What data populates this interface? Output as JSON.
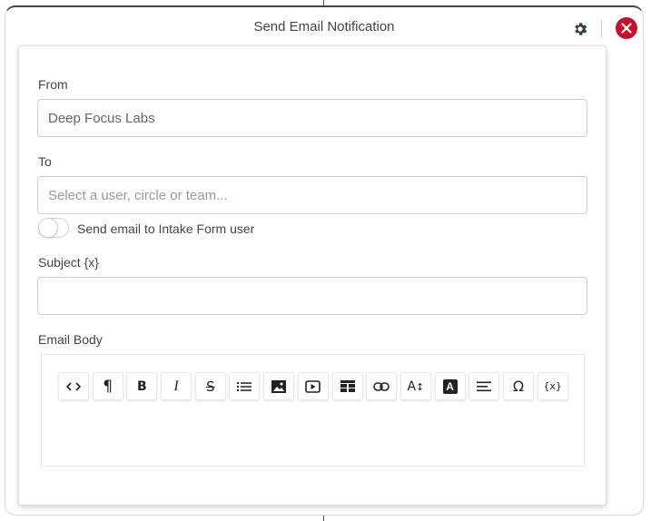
{
  "dialog": {
    "title": "Send Email Notification",
    "close_color": "#c8102e"
  },
  "form": {
    "from": {
      "label": "From",
      "value": "Deep Focus Labs"
    },
    "to": {
      "label": "To",
      "placeholder": "Select a user, circle or team..."
    },
    "intake_toggle": {
      "label": "Send email to Intake Form user",
      "checked": false
    },
    "subject": {
      "label": "Subject {x}",
      "value": ""
    },
    "body": {
      "label": "Email Body"
    }
  },
  "toolbar": {
    "buttons": [
      {
        "name": "code-view-button",
        "icon": "code-icon",
        "glyph": "<>"
      },
      {
        "name": "paragraph-format-button",
        "icon": "paragraph-icon",
        "glyph": "¶"
      },
      {
        "name": "bold-button",
        "icon": "bold-icon",
        "glyph": "B"
      },
      {
        "name": "italic-button",
        "icon": "italic-icon",
        "glyph": "I"
      },
      {
        "name": "strikethrough-button",
        "icon": "strikethrough-icon",
        "glyph": "S"
      },
      {
        "name": "bulleted-list-button",
        "icon": "list-icon",
        "glyph": ""
      },
      {
        "name": "insert-image-button",
        "icon": "image-icon",
        "glyph": ""
      },
      {
        "name": "insert-video-button",
        "icon": "video-icon",
        "glyph": ""
      },
      {
        "name": "insert-table-button",
        "icon": "table-icon",
        "glyph": ""
      },
      {
        "name": "insert-link-button",
        "icon": "link-icon",
        "glyph": ""
      },
      {
        "name": "font-size-button",
        "icon": "font-size-icon",
        "glyph": "A"
      },
      {
        "name": "text-color-button",
        "icon": "text-color-icon",
        "glyph": "A"
      },
      {
        "name": "align-button",
        "icon": "align-left-icon",
        "glyph": ""
      },
      {
        "name": "special-characters-button",
        "icon": "omega-icon",
        "glyph": "Ω"
      },
      {
        "name": "insert-variable-button",
        "icon": "variable-icon",
        "glyph": "{x}"
      }
    ]
  }
}
